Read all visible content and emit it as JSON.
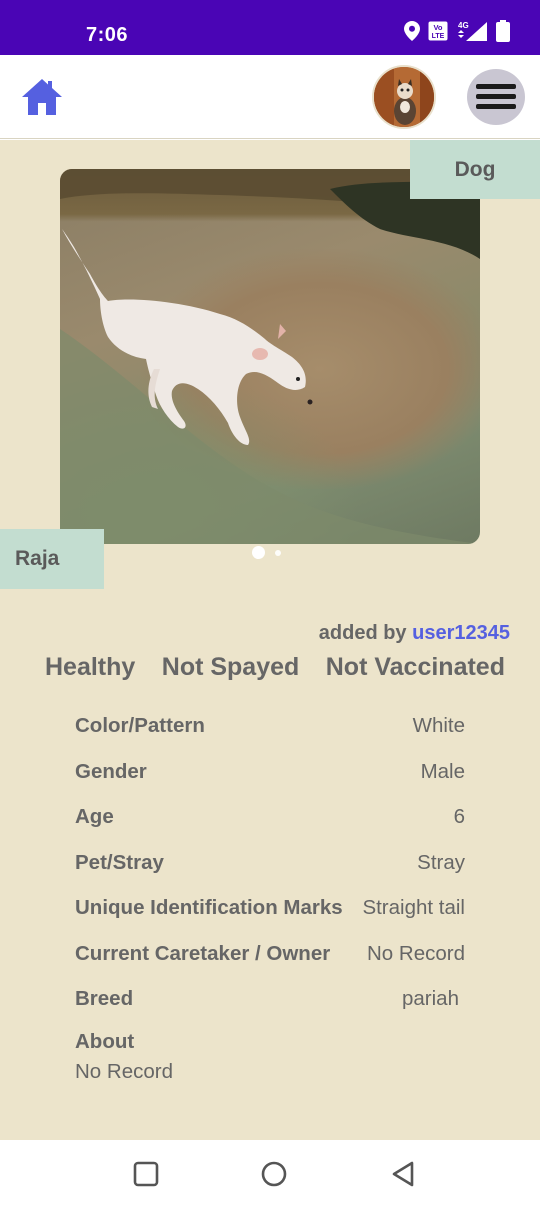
{
  "status_bar": {
    "time": "7:06",
    "icons": [
      "location-icon",
      "volte-icon",
      "4g-signal-icon",
      "battery-icon"
    ]
  },
  "app_bar": {
    "home_icon": "home-icon",
    "avatar_icon": "user-avatar",
    "menu_icon": "hamburger-menu-icon"
  },
  "pet": {
    "type": "Dog",
    "name": "Raja",
    "added_by_label": "added by",
    "added_by_user": "user12345",
    "health": "Healthy",
    "spay_status": "Not Spayed",
    "vaccination": "Not Vaccinated",
    "details": [
      {
        "label": "Color/Pattern",
        "value": "White"
      },
      {
        "label": "Gender",
        "value": "Male"
      },
      {
        "label": "Age",
        "value": "6"
      },
      {
        "label": "Pet/Stray",
        "value": "Stray"
      },
      {
        "label": "Unique Identification Marks",
        "value": "Straight tail"
      },
      {
        "label": "Current Caretaker / Owner",
        "value": "No Record"
      },
      {
        "label": "Breed",
        "value": "pariah"
      }
    ],
    "about_label": "About",
    "about_value": "No Record"
  },
  "carousel": {
    "pages": 2,
    "active": 1
  },
  "colors": {
    "status_bar": "#4a05b5",
    "background": "#ece4cb",
    "tag": "#c3ddd0",
    "link": "#5560e0",
    "home_icon": "#5560e0"
  },
  "nav_bar": {
    "icons": [
      "recents-square-icon",
      "home-circle-icon",
      "back-triangle-icon"
    ]
  }
}
